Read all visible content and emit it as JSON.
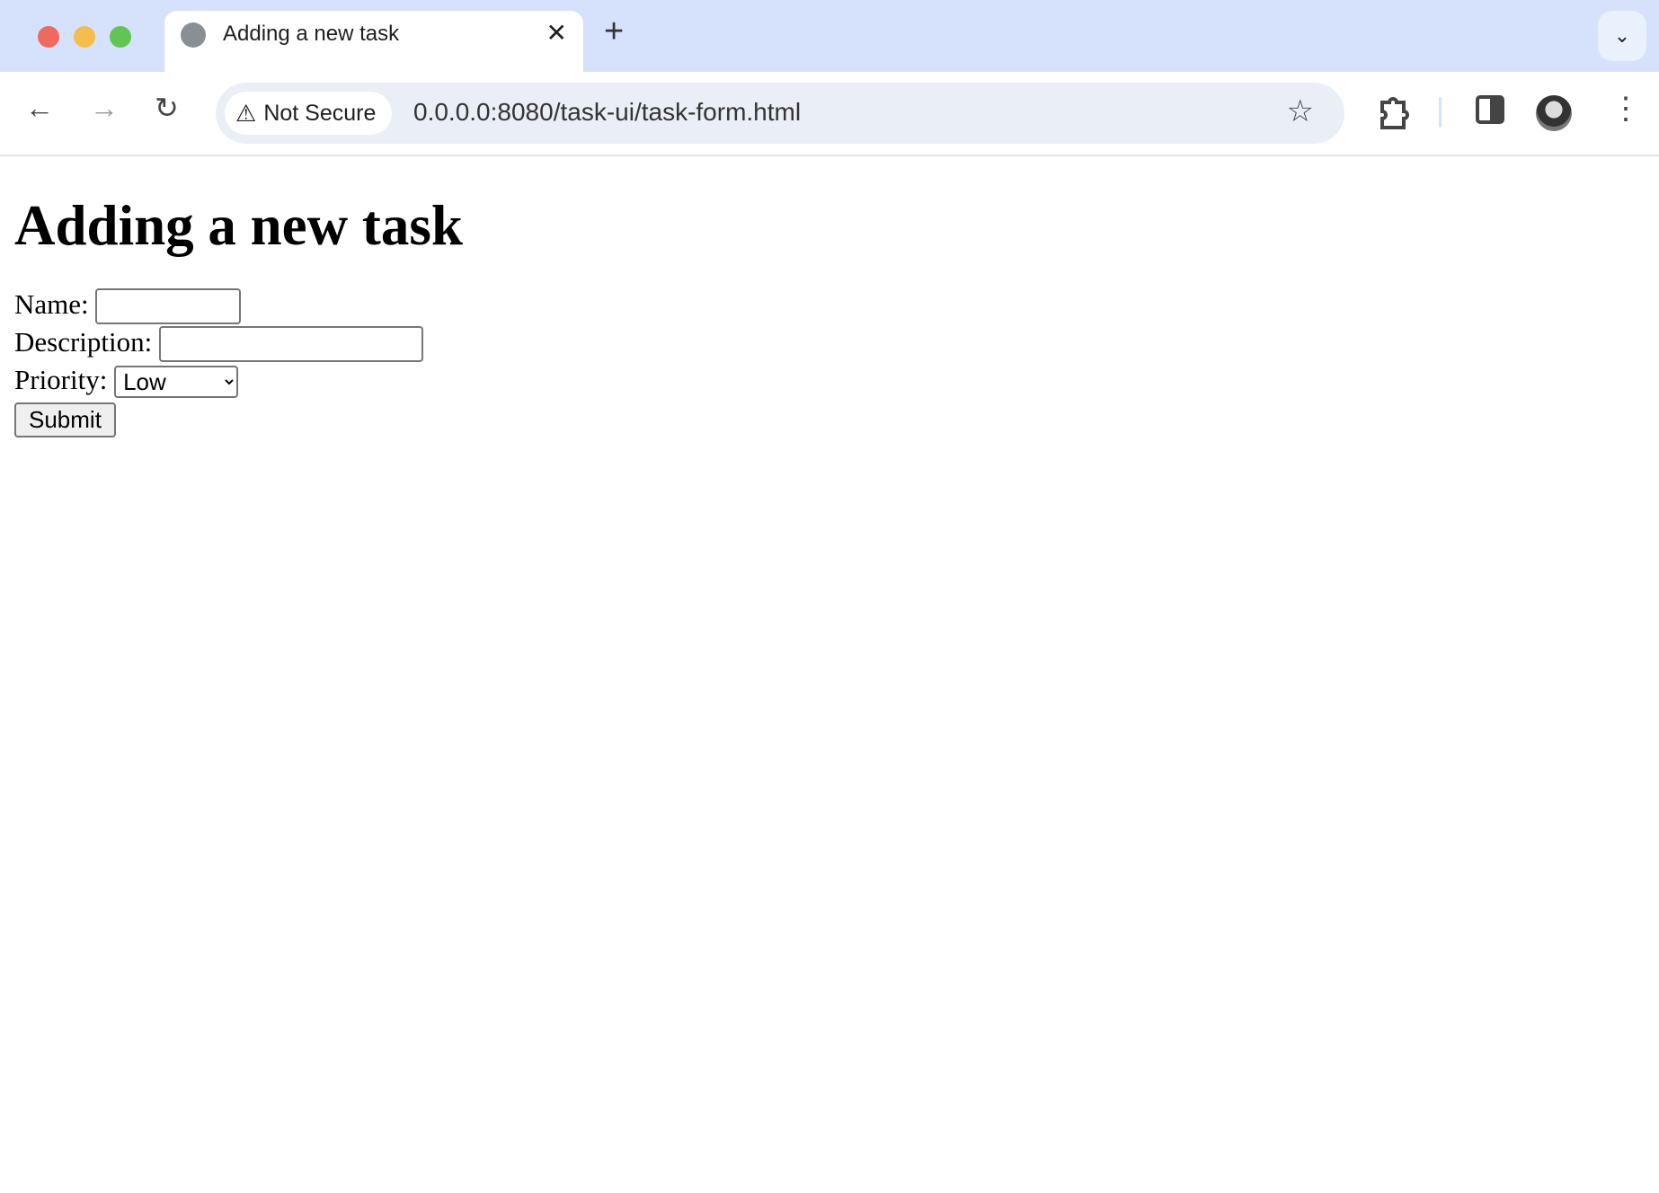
{
  "browser": {
    "tab": {
      "title": "Adding a new task",
      "favicon": "globe-icon",
      "close_glyph": "✕"
    },
    "new_tab_glyph": "+",
    "tab_search_glyph": "⌄",
    "nav": {
      "back": "←",
      "forward": "→",
      "reload": "↻"
    },
    "security_chip": {
      "icon": "⚠",
      "label": "Not Secure"
    },
    "url": "0.0.0.0:8080/task-ui/task-form.html",
    "bookmark_glyph": "☆",
    "menu_glyph": "⋮",
    "traffic_lights": {
      "close": "#ee6a5f",
      "minimize": "#f5bd4f",
      "maximize": "#61c454"
    }
  },
  "page": {
    "heading": "Adding a new task",
    "form": {
      "name_label": "Name:",
      "name_value": "",
      "description_label": "Description:",
      "description_value": "",
      "priority_label": "Priority:",
      "priority_selected": "Low",
      "submit_label": "Submit"
    }
  }
}
